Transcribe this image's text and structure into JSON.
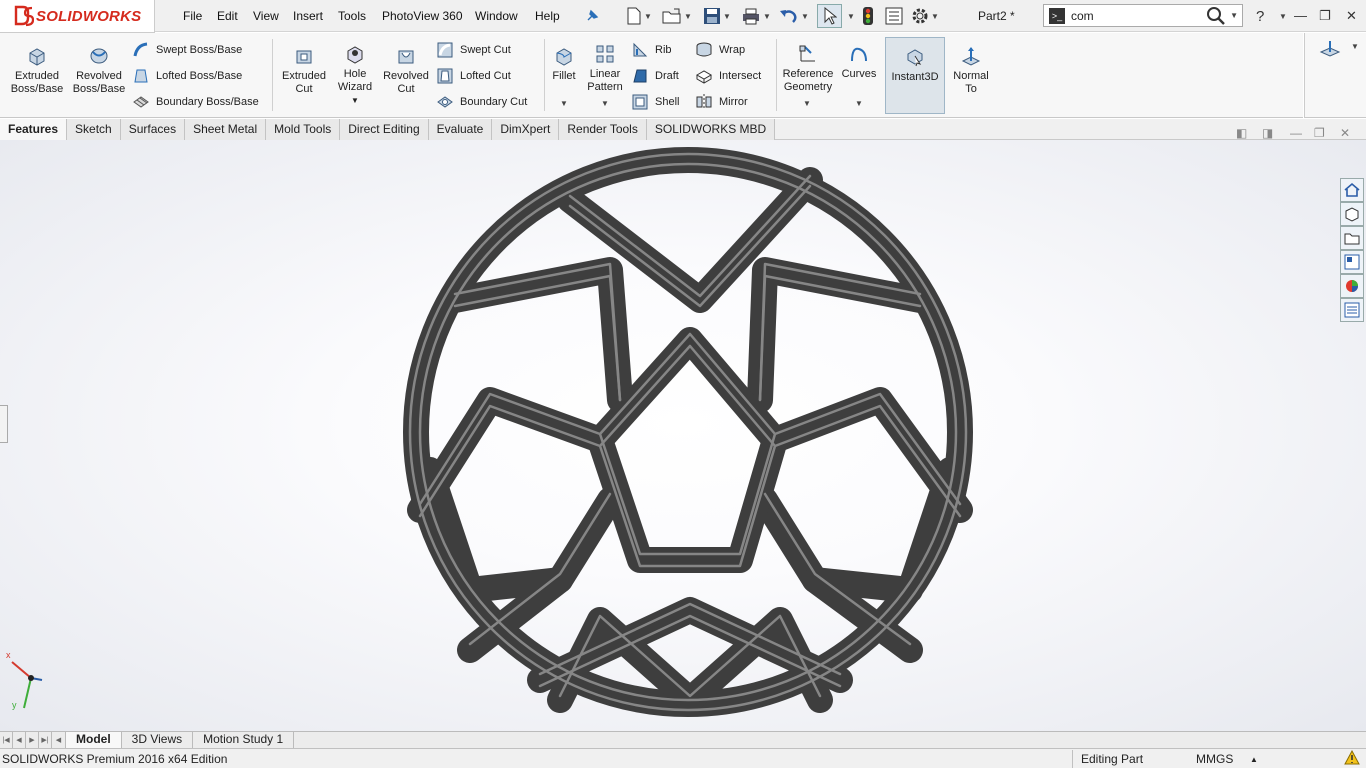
{
  "app": {
    "brand": "SOLIDWORKS",
    "doc_title": "Part2 *"
  },
  "menu": [
    "File",
    "Edit",
    "View",
    "Insert",
    "Tools",
    "PhotoView 360",
    "Window",
    "Help"
  ],
  "search": {
    "value": "com"
  },
  "ribbon": {
    "extruded_boss": [
      "Extruded",
      "Boss/Base"
    ],
    "revolved_boss": [
      "Revolved",
      "Boss/Base"
    ],
    "swept_boss": "Swept Boss/Base",
    "lofted_boss": "Lofted Boss/Base",
    "boundary_boss": "Boundary Boss/Base",
    "extruded_cut": [
      "Extruded",
      "Cut"
    ],
    "hole_wizard": [
      "Hole",
      "Wizard"
    ],
    "revolved_cut": [
      "Revolved",
      "Cut"
    ],
    "swept_cut": "Swept Cut",
    "lofted_cut": "Lofted Cut",
    "boundary_cut": "Boundary Cut",
    "fillet": "Fillet",
    "linear_pattern": [
      "Linear",
      "Pattern"
    ],
    "rib": "Rib",
    "draft": "Draft",
    "shell": "Shell",
    "wrap": "Wrap",
    "intersect": "Intersect",
    "mirror": "Mirror",
    "reference_geometry": [
      "Reference",
      "Geometry"
    ],
    "curves": "Curves",
    "instant3d": "Instant3D",
    "normal_to": [
      "Normal",
      "To"
    ]
  },
  "tabs": [
    "Features",
    "Sketch",
    "Surfaces",
    "Sheet Metal",
    "Mold Tools",
    "Direct Editing",
    "Evaluate",
    "DimXpert",
    "Render Tools",
    "SOLIDWORKS MBD"
  ],
  "bottom_tabs": [
    "Model",
    "3D Views",
    "Motion Study 1"
  ],
  "status": {
    "edition": "SOLIDWORKS Premium 2016 x64 Edition",
    "mode": "Editing Part",
    "units": "MMGS"
  },
  "triad": {
    "x": "x",
    "y": "y"
  },
  "colors": {
    "accent": "#d52b1e",
    "active_tool": "#dde4ea",
    "model": "#5a5a5a"
  }
}
